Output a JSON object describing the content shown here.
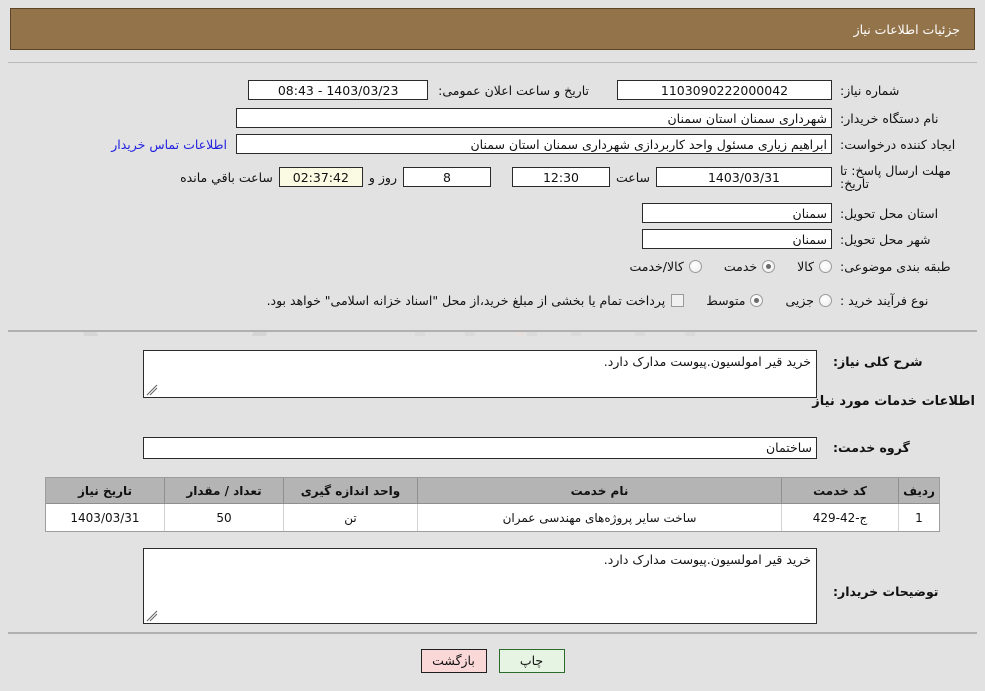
{
  "header": {
    "title": "جزئیات اطلاعات نیاز"
  },
  "form": {
    "need_number": {
      "label": "شماره نیاز:",
      "value": "1103090222000042"
    },
    "public_announce": {
      "label": "تاریخ و ساعت اعلان عمومی:",
      "value": "1403/03/23 - 08:43"
    },
    "buyer_org": {
      "label": "نام دستگاه خریدار:",
      "value": "شهرداری سمنان استان سمنان"
    },
    "request_creator": {
      "label": "ایجاد کننده درخواست:",
      "value": "ابراهیم زیاری مسئول واحد کاربردازی شهرداری سمنان استان سمنان"
    },
    "buyer_contact_link": "اطلاعات تماس خریدار",
    "deadline": {
      "label": "مهلت ارسال پاسخ: تا تاریخ:",
      "date": "1403/03/31",
      "time_label": "ساعت",
      "time": "12:30",
      "days": "8",
      "days_label": "روز و",
      "remaining": "02:37:42",
      "remaining_label": "ساعت باقي مانده"
    },
    "delivery_province": {
      "label": "استان محل تحویل:",
      "value": "سمنان"
    },
    "delivery_city": {
      "label": "شهر محل تحویل:",
      "value": "سمنان"
    },
    "category": {
      "label": "طبقه بندی موضوعی:",
      "options": [
        "کالا",
        "خدمت",
        "کالا/خدمت"
      ],
      "selected": "خدمت"
    },
    "purchase_type": {
      "label": "نوع فرآیند خرید :",
      "options": [
        "جزیی",
        "متوسط"
      ],
      "selected": "متوسط",
      "checkbox_label": "پرداخت تمام یا بخشی از مبلغ خرید،از محل \"اسناد خزانه اسلامی\" خواهد بود.",
      "checkbox_checked": false
    }
  },
  "need_summary": {
    "label": "شرح کلی نیاز:",
    "value": "خرید قیر امولسیون.پیوست مدارک دارد."
  },
  "services_section": {
    "heading": "اطلاعات خدمات مورد نیاز",
    "service_group": {
      "label": "گروه خدمت:",
      "value": "ساختمان"
    }
  },
  "table": {
    "columns": [
      "ردیف",
      "کد خدمت",
      "نام خدمت",
      "واحد اندازه گیری",
      "تعداد / مقدار",
      "تاریخ نیاز"
    ],
    "rows": [
      {
        "row": "1",
        "code": "ج-42-429",
        "name": "ساخت سایر پروژه‌های مهندسی عمران",
        "unit": "تن",
        "quantity": "50",
        "date": "1403/03/31"
      }
    ]
  },
  "buyer_notes": {
    "label": "توضیحات خریدار:",
    "value": "خرید قیر امولسیون.پیوست مدارک دارد."
  },
  "buttons": {
    "back": "بازگشت",
    "print": "چاپ"
  },
  "watermark": {
    "text": "AnaTender.net"
  },
  "colors": {
    "header_bg": "#93734a",
    "page_bg": "#e2e2e2",
    "link": "#2020e0",
    "table_header_bg": "#b4b4b4",
    "btn_back_bg": "#fbd8d8",
    "btn_print_bg": "#e6f5e3",
    "field_highlight_bg": "#fbfbe4"
  }
}
